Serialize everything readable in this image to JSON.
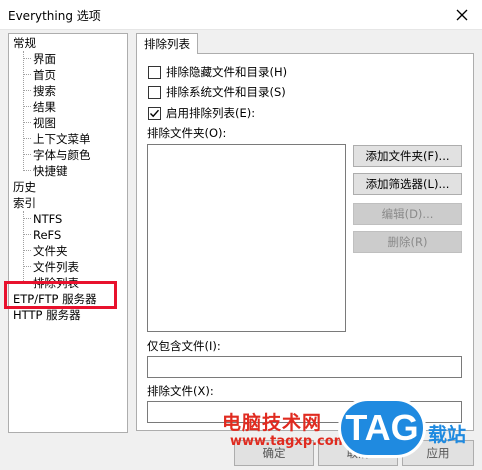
{
  "window": {
    "title": "Everything 选项"
  },
  "tree": {
    "items": [
      {
        "label": "常规"
      },
      {
        "label": "界面"
      },
      {
        "label": "首页"
      },
      {
        "label": "搜索"
      },
      {
        "label": "结果"
      },
      {
        "label": "视图"
      },
      {
        "label": "上下文菜单"
      },
      {
        "label": "字体与颜色"
      },
      {
        "label": "快捷键"
      },
      {
        "label": "历史"
      },
      {
        "label": "索引"
      },
      {
        "label": "NTFS"
      },
      {
        "label": "ReFS"
      },
      {
        "label": "文件夹"
      },
      {
        "label": "文件列表"
      },
      {
        "label": "排除列表"
      },
      {
        "label": "ETP/FTP 服务器"
      },
      {
        "label": "HTTP 服务器"
      }
    ]
  },
  "tab": {
    "label": "排除列表"
  },
  "options": {
    "hidden": {
      "label": "排除隐藏文件和目录(H)",
      "checked": false
    },
    "system": {
      "label": "排除系统文件和目录(S)",
      "checked": false
    },
    "enable": {
      "label": "启用排除列表(E):",
      "checked": true
    }
  },
  "folders": {
    "label": "排除文件夹(O):"
  },
  "buttons": {
    "add_folder": "添加文件夹(F)...",
    "add_filter": "添加筛选器(L)...",
    "edit": "编辑(D)...",
    "delete": "删除(R)"
  },
  "include_files": {
    "label": "仅包含文件(I):",
    "value": ""
  },
  "exclude_files": {
    "label": "排除文件(X):",
    "value": ""
  },
  "footer": {
    "ok": "确定",
    "cancel": "取消",
    "apply": "应用"
  },
  "watermark": {
    "text": "电脑技术网",
    "url": "www.tagxp.com",
    "logo": "TAG",
    "side": "载站"
  },
  "colors": {
    "highlight": "#e8112d",
    "watermark_red": "#e02b20",
    "watermark_blue": "#1f8ae0"
  }
}
